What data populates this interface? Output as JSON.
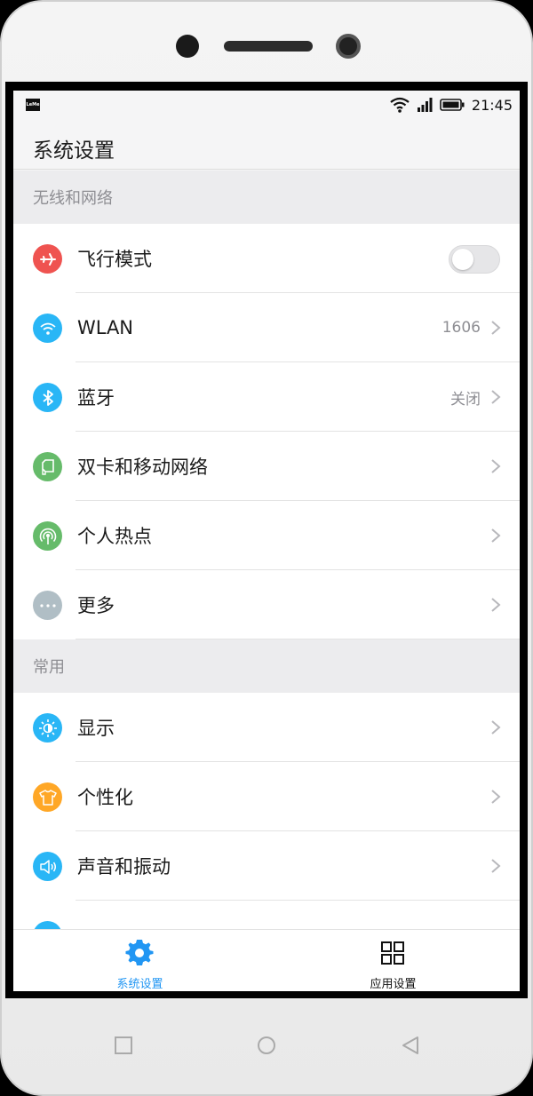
{
  "status_bar": {
    "brand": "LeMe",
    "time": "21:45",
    "icons": [
      "wifi-icon",
      "signal-icon",
      "battery-icon"
    ]
  },
  "header": {
    "title": "系统设置"
  },
  "sections": [
    {
      "title": "无线和网络",
      "items": [
        {
          "label": "飞行模式",
          "icon": "airplane-icon",
          "color": "#ef5350",
          "type": "toggle",
          "toggle_on": false
        },
        {
          "label": "WLAN",
          "icon": "wifi-icon",
          "color": "#29b6f6",
          "value": "1606"
        },
        {
          "label": "蓝牙",
          "icon": "bluetooth-icon",
          "color": "#29b6f6",
          "value": "关闭"
        },
        {
          "label": "双卡和移动网络",
          "icon": "sim-card-icon",
          "color": "#66bb6a"
        },
        {
          "label": "个人热点",
          "icon": "hotspot-icon",
          "color": "#66bb6a"
        },
        {
          "label": "更多",
          "icon": "more-icon",
          "color": "#b0bec5"
        }
      ]
    },
    {
      "title": "常用",
      "items": [
        {
          "label": "显示",
          "icon": "brightness-icon",
          "color": "#29b6f6"
        },
        {
          "label": "个性化",
          "icon": "tshirt-icon",
          "color": "#ffa726"
        },
        {
          "label": "声音和振动",
          "icon": "speaker-icon",
          "color": "#29b6f6"
        }
      ]
    }
  ],
  "bottom_nav": [
    {
      "label": "系统设置",
      "icon": "gear-icon",
      "active": true,
      "color": "#2196f3"
    },
    {
      "label": "应用设置",
      "icon": "grid-icon",
      "active": false,
      "color": "#111111"
    }
  ],
  "softkeys": [
    "square-icon",
    "circle-icon",
    "triangle-back-icon"
  ]
}
